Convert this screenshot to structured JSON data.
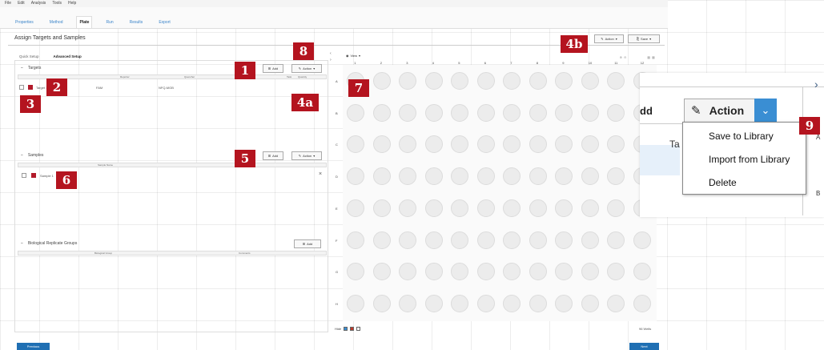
{
  "menubar": [
    "File",
    "Edit",
    "Analysis",
    "Tools",
    "Help"
  ],
  "tabs": [
    "Properties",
    "Method",
    "Plate",
    "Run",
    "Results",
    "Export"
  ],
  "page_title": "Assign Targets and Samples",
  "subtabs": [
    "Quick Setup",
    "Advanced Setup"
  ],
  "targets": {
    "title": "Targets",
    "add": "Add",
    "action": "Action",
    "cols": [
      "Reporter",
      "Quencher",
      "Task",
      "Quantity"
    ],
    "row": {
      "name": "Target 1",
      "reporter": "FAM",
      "quencher": "NFQ-MGB"
    }
  },
  "samples": {
    "title": "Samples",
    "add": "Add",
    "action": "Action",
    "col": "Sample Name",
    "row": "Sample 1"
  },
  "bio_groups": {
    "title": "Biological Replicate Groups",
    "add": "Add",
    "cols": [
      "Biological Group",
      "Comments"
    ]
  },
  "top_right": {
    "action": "Action",
    "save": "Save"
  },
  "plate": {
    "view": "View",
    "cols": [
      "1",
      "2",
      "3",
      "4",
      "5",
      "6",
      "7",
      "8",
      "9",
      "10",
      "11",
      "12"
    ],
    "rows": [
      "A",
      "B",
      "C",
      "D",
      "E",
      "F",
      "G",
      "H"
    ],
    "wells_count": "96 Wells",
    "legend": "Hide"
  },
  "zoom": {
    "add_partial": "dd",
    "action": "Action",
    "task_partial": "Ta",
    "menu": [
      "Save to Library",
      "Import from Library",
      "Delete"
    ],
    "row_labels": [
      "A",
      "B"
    ]
  },
  "badges": {
    "b1": "1",
    "b2": "2",
    "b3": "3",
    "b4a": "4a",
    "b4b": "4b",
    "b5": "5",
    "b6": "6",
    "b7": "7",
    "b8": "8",
    "b9": "9"
  },
  "footer": {
    "prev": "Previous",
    "next": "Next"
  }
}
